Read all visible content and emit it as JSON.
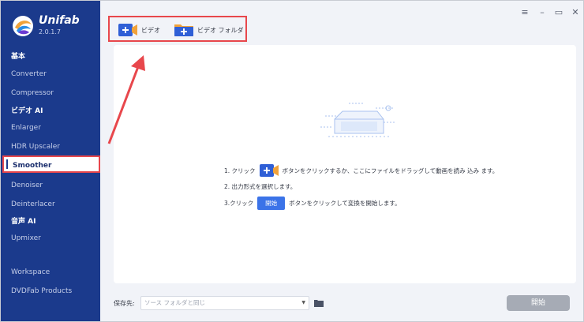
{
  "app": {
    "name": "Unifab",
    "version": "2.0.1.7"
  },
  "sidebar": {
    "items": [
      {
        "label": "基本",
        "type": "category"
      },
      {
        "label": "Converter",
        "type": "item"
      },
      {
        "label": "Compressor",
        "type": "item"
      },
      {
        "label": "ビデオ AI",
        "type": "category"
      },
      {
        "label": "Enlarger",
        "type": "item"
      },
      {
        "label": "HDR Upscaler",
        "type": "item"
      },
      {
        "label": "Smoother",
        "type": "active"
      },
      {
        "label": "Denoiser",
        "type": "item"
      },
      {
        "label": "Deinterlacer",
        "type": "item"
      },
      {
        "label": "音声 AI",
        "type": "category"
      },
      {
        "label": "Upmixer",
        "type": "item"
      },
      {
        "label": "Workspace",
        "type": "item"
      },
      {
        "label": "DVDFab Products",
        "type": "item"
      }
    ]
  },
  "window_controls": {
    "menu": "≡",
    "minimize": "–",
    "maximize": "▭",
    "close": "✕"
  },
  "toolbar": {
    "add_video_label": "ビデオ",
    "add_folder_label": "ビデオ フォルダ"
  },
  "instructions": {
    "step1_prefix": "1. クリック",
    "step1_suffix": "ボタンをクリックするか、ここにファイルをドラッグして動画を読み 込み ます。",
    "step2": "2. 出力形式を選択します。",
    "step3_prefix": "3.クリック",
    "step3_button": "開始",
    "step3_suffix": "ボタンをクリックして変換を開始します。"
  },
  "bottom": {
    "save_label": "保存先:",
    "save_value": "ソース フォルダと同じ",
    "start_label": "開始"
  },
  "colors": {
    "sidebar_bg": "#1b3a8c",
    "accent_blue": "#3b73e8",
    "highlight_red": "#e8474c",
    "start_disabled": "#a6abb5"
  }
}
